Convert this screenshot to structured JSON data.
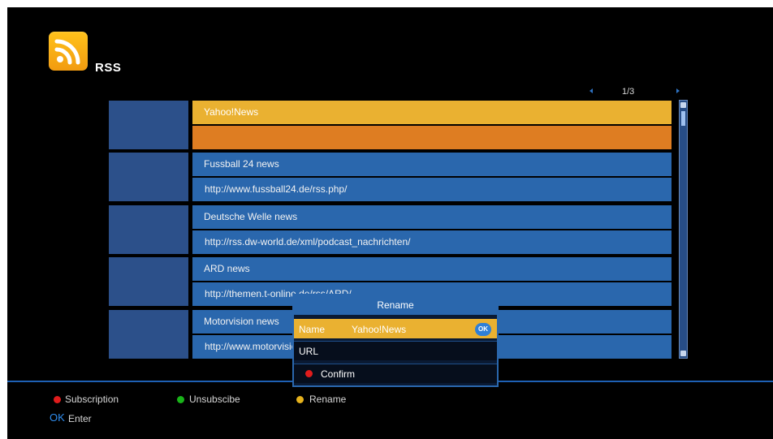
{
  "app": {
    "title": "RSS"
  },
  "pager": {
    "label": "1/3"
  },
  "feeds": [
    {
      "name": "Yahoo!News",
      "url": "",
      "selected": true
    },
    {
      "name": "Fussball 24 news",
      "url": "http://www.fussball24.de/rss.php/"
    },
    {
      "name": "Deutsche Welle news",
      "url": "http://rss.dw-world.de/xml/podcast_nachrichten/"
    },
    {
      "name": "ARD news",
      "url": "http://themen.t-online.de/rss/ARD/"
    },
    {
      "name": "Motorvision news",
      "url": "http://www.motorvision.de/rss/"
    }
  ],
  "dialog": {
    "title": "Rename",
    "name_label": "Name",
    "name_value": "Yahoo!News",
    "ok_badge": "OK",
    "url_label": "URL",
    "confirm_label": "Confirm"
  },
  "footer": {
    "subscription": "Subscription",
    "unsubscribe": "Unsubscibe",
    "rename": "Rename",
    "ok_key": "OK",
    "enter": "Enter"
  },
  "colors": {
    "selection_top": "#eab131",
    "selection_bottom": "#de7d22",
    "row_blue": "#2a67ad",
    "red": "#e01c1c",
    "green": "#19b319",
    "yellow": "#e6b21d"
  },
  "icons": [
    "rss-icon",
    "page-left-icon",
    "page-right-icon",
    "red-key-icon",
    "green-key-icon",
    "yellow-key-icon"
  ]
}
